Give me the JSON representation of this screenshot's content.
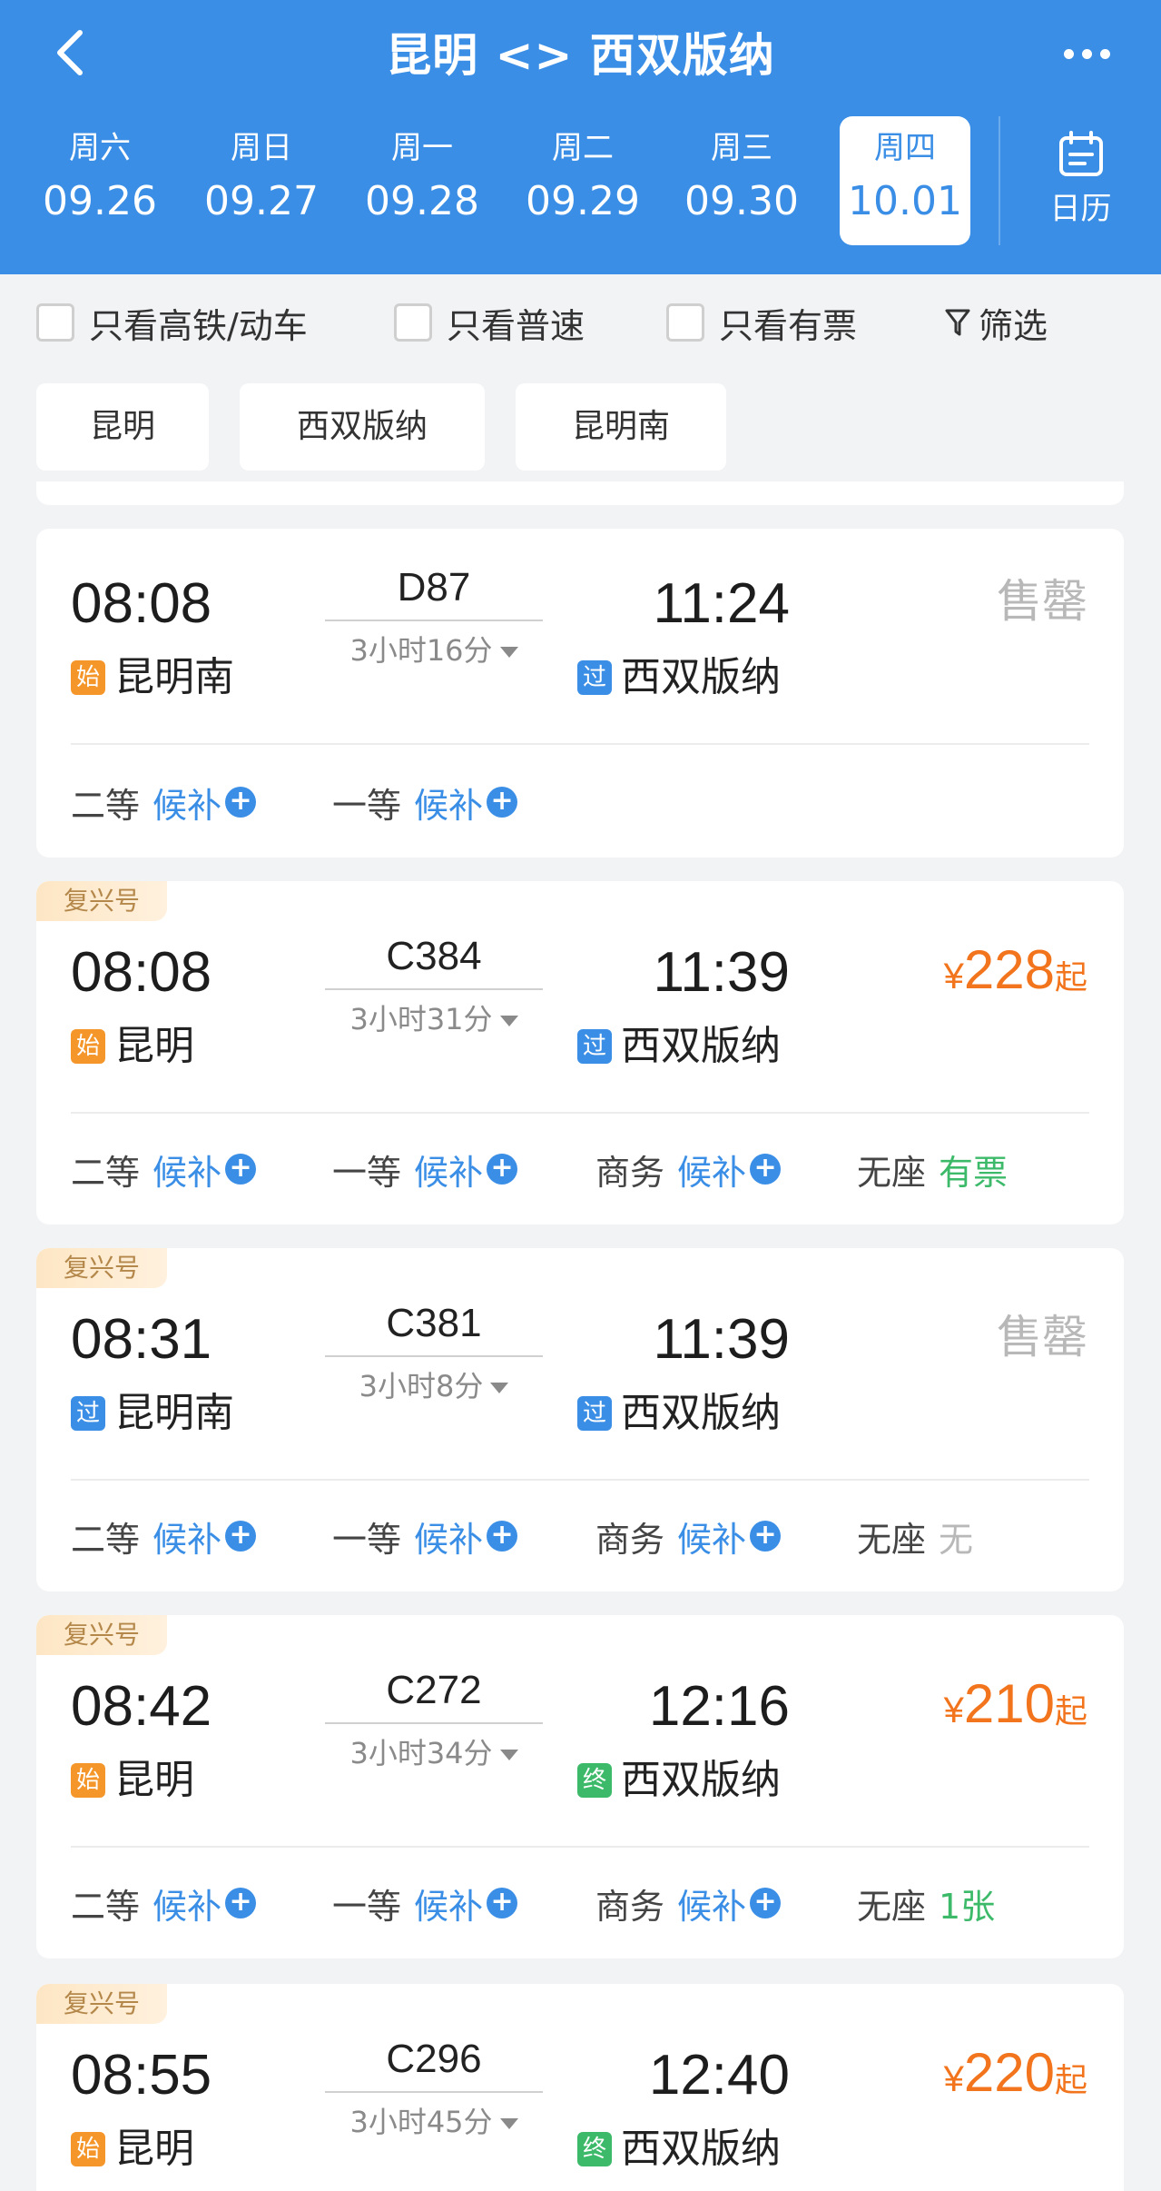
{
  "header": {
    "title": "昆明 <> 西双版纳",
    "calendar_label": "日历",
    "dates": [
      {
        "weekday": "周六",
        "date": "09.26",
        "active": false
      },
      {
        "weekday": "周日",
        "date": "09.27",
        "active": false
      },
      {
        "weekday": "周一",
        "date": "09.28",
        "active": false
      },
      {
        "weekday": "周二",
        "date": "09.29",
        "active": false
      },
      {
        "weekday": "周三",
        "date": "09.30",
        "active": false
      },
      {
        "weekday": "周四",
        "date": "10.01",
        "active": true
      }
    ]
  },
  "filters": {
    "high_speed": "只看高铁/动车",
    "normal_speed": "只看普速",
    "has_ticket": "只看有票",
    "filter": "筛选"
  },
  "stations": [
    "昆明",
    "西双版纳",
    "昆明南"
  ],
  "trains": [
    {
      "fuxing": false,
      "fuxing_label": "",
      "dep_time": "08:08",
      "dep_tag": "始",
      "dep_station": "昆明南",
      "train_no": "D87",
      "duration": "3小时16分",
      "arr_time": "11:24",
      "arr_tag": "过",
      "arr_station": "西双版纳",
      "status": "售罄",
      "price": "",
      "price_suffix": "",
      "seats": [
        {
          "cls": "二等",
          "status": "候补",
          "type": "waitlist"
        },
        {
          "cls": "一等",
          "status": "候补",
          "type": "waitlist"
        }
      ]
    },
    {
      "fuxing": true,
      "fuxing_label": "复兴号",
      "dep_time": "08:08",
      "dep_tag": "始",
      "dep_station": "昆明",
      "train_no": "C384",
      "duration": "3小时31分",
      "arr_time": "11:39",
      "arr_tag": "过",
      "arr_station": "西双版纳",
      "status": "",
      "price": "228",
      "price_suffix": "起",
      "seats": [
        {
          "cls": "二等",
          "status": "候补",
          "type": "waitlist"
        },
        {
          "cls": "一等",
          "status": "候补",
          "type": "waitlist"
        },
        {
          "cls": "商务",
          "status": "候补",
          "type": "waitlist"
        },
        {
          "cls": "无座",
          "status": "有票",
          "type": "available"
        }
      ]
    },
    {
      "fuxing": true,
      "fuxing_label": "复兴号",
      "dep_time": "08:31",
      "dep_tag": "过",
      "dep_station": "昆明南",
      "train_no": "C381",
      "duration": "3小时8分",
      "arr_time": "11:39",
      "arr_tag": "过",
      "arr_station": "西双版纳",
      "status": "售罄",
      "price": "",
      "price_suffix": "",
      "seats": [
        {
          "cls": "二等",
          "status": "候补",
          "type": "waitlist"
        },
        {
          "cls": "一等",
          "status": "候补",
          "type": "waitlist"
        },
        {
          "cls": "商务",
          "status": "候补",
          "type": "waitlist"
        },
        {
          "cls": "无座",
          "status": "无",
          "type": "none"
        }
      ]
    },
    {
      "fuxing": true,
      "fuxing_label": "复兴号",
      "dep_time": "08:42",
      "dep_tag": "始",
      "dep_station": "昆明",
      "train_no": "C272",
      "duration": "3小时34分",
      "arr_time": "12:16",
      "arr_tag": "终",
      "arr_station": "西双版纳",
      "status": "",
      "price": "210",
      "price_suffix": "起",
      "seats": [
        {
          "cls": "二等",
          "status": "候补",
          "type": "waitlist"
        },
        {
          "cls": "一等",
          "status": "候补",
          "type": "waitlist"
        },
        {
          "cls": "商务",
          "status": "候补",
          "type": "waitlist"
        },
        {
          "cls": "无座",
          "status": "1张",
          "type": "available"
        }
      ]
    },
    {
      "fuxing": true,
      "fuxing_label": "复兴号",
      "dep_time": "08:55",
      "dep_tag": "始",
      "dep_station": "昆明",
      "train_no": "C296",
      "duration": "3小时45分",
      "arr_time": "12:40",
      "arr_tag": "终",
      "arr_station": "西双版纳",
      "status": "",
      "price": "220",
      "price_suffix": "起",
      "seats": []
    }
  ],
  "colors": {
    "brand_blue": "#3a8ee6",
    "price_orange": "#f2741c",
    "available_green": "#3cba6a",
    "sold_out_gray": "#b8b8b8"
  }
}
